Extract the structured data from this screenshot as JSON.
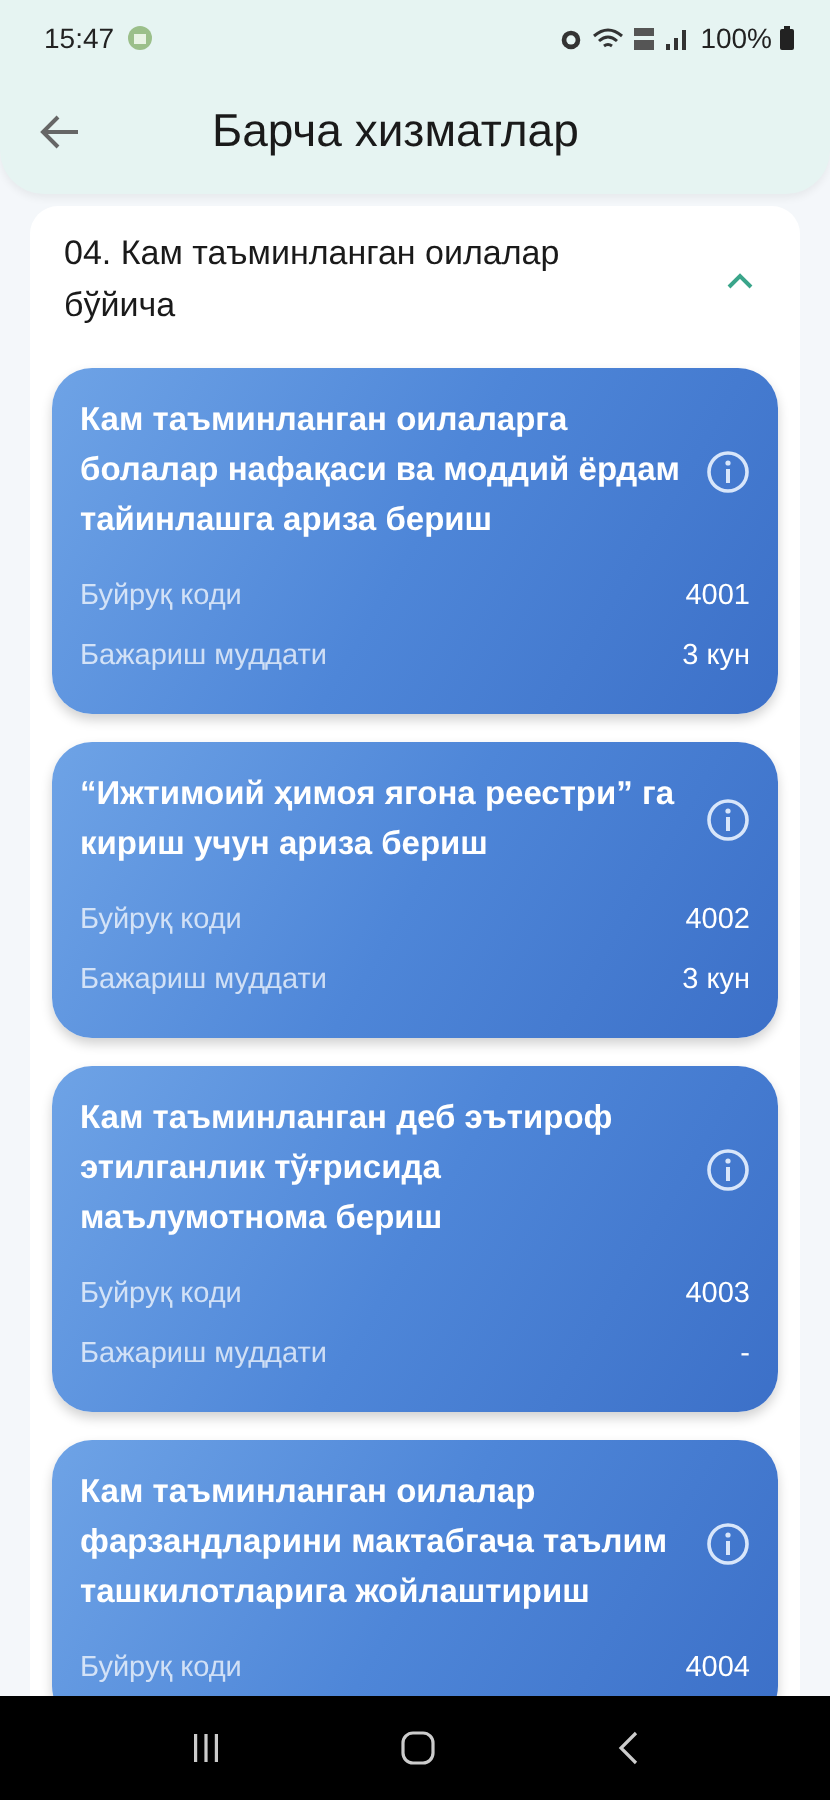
{
  "status_bar": {
    "time": "15:47",
    "battery": "100%"
  },
  "header": {
    "title": "Барча хизматлар"
  },
  "section": {
    "title": "04. Кам таъминланган оилалар бўйича",
    "expanded": true,
    "services": [
      {
        "title": "Кам таъминланган оилаларга болалар нафақаси ва моддий ёрдам тайинлашга ариза бериш",
        "rows": [
          {
            "label": "Буйруқ коди",
            "value": "4001"
          },
          {
            "label": "Бажариш муддати",
            "value": "3 кун"
          }
        ]
      },
      {
        "title": "“Ижтимоий ҳимоя ягона реестри” га кириш учун ариза бериш",
        "rows": [
          {
            "label": "Буйруқ коди",
            "value": "4002"
          },
          {
            "label": "Бажариш муддати",
            "value": "3 кун"
          }
        ]
      },
      {
        "title": "Кам таъминланган деб эътироф этилганлик тўғрисида маълумотнома бериш",
        "rows": [
          {
            "label": "Буйруқ коди",
            "value": "4003"
          },
          {
            "label": "Бажариш муддати",
            "value": "-"
          }
        ]
      },
      {
        "title": "Кам таъминланган оилалар фарзандларини мактабгача таълим ташкилотларига жойлаштириш",
        "rows": [
          {
            "label": "Буйруқ коди",
            "value": "4004"
          }
        ]
      }
    ]
  }
}
